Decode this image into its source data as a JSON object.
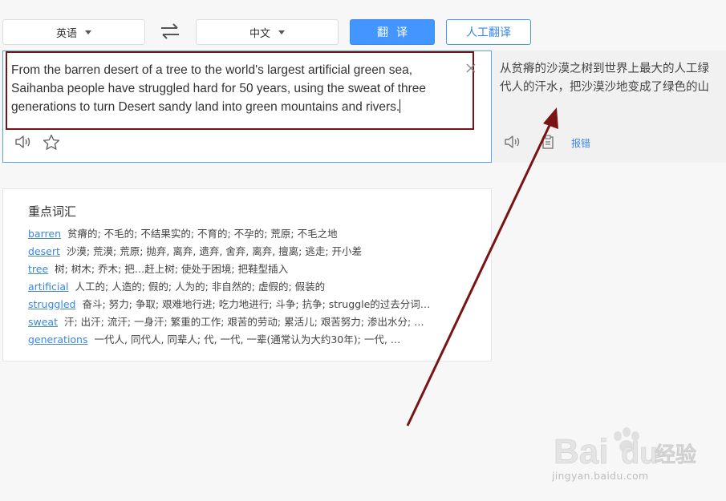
{
  "toolbar": {
    "source_lang": "英语",
    "target_lang": "中文",
    "translate_label": "翻译",
    "human_translate_label": "人工翻译"
  },
  "input": {
    "lines": [
      "From the barren desert of a tree to the world's largest artificial green sea,",
      "Saihanba people have struggled hard for 50 years, using the sweat of three",
      "generations to turn Desert sandy land into green mountains and rivers."
    ]
  },
  "output": {
    "lines": [
      "从贫瘠的沙漠之树到世界上最大的人工绿",
      "代人的汗水，把沙漠沙地变成了绿色的山"
    ],
    "report_label": "报错"
  },
  "keywords": {
    "title": "重点词汇",
    "items": [
      {
        "word": "barren",
        "def": "贫瘠的; 不毛的; 不结果实的; 不育的; 不孕的; 荒原; 不毛之地"
      },
      {
        "word": "desert",
        "def": "沙漠; 荒漠; 荒原; 抛弃, 离弃, 遗弃, 舍弃, 离弃, 擅离; 逃走; 开小差"
      },
      {
        "word": "tree",
        "def": "树; 树木; 乔木; 把…赶上树; 使处于困境; 把鞋型插入"
      },
      {
        "word": "artificial",
        "def": "人工的; 人造的; 假的; 人为的; 非自然的; 虚假的; 假装的"
      },
      {
        "word": "struggled",
        "def": "奋斗; 努力; 争取; 艰难地行进; 吃力地进行; 斗争; 抗争; struggle的过去分词…"
      },
      {
        "word": "sweat",
        "def": "汗; 出汗; 流汗; 一身汗; 繁重的工作; 艰苦的劳动; 累活儿; 艰苦努力; 渗出水分; …"
      },
      {
        "word": "generations",
        "def": "一代人, 同代人, 同辈人; 代, 一代, 一辈(通常认为大约30年); 一代, …"
      }
    ]
  },
  "watermark": {
    "brand": "Bai",
    "brand_tail": "du",
    "cn": "经验",
    "url": "jingyan.baidu.com"
  },
  "colors": {
    "accent": "#4395ff",
    "link": "#3a85e8",
    "annotation": "#7a1414"
  }
}
